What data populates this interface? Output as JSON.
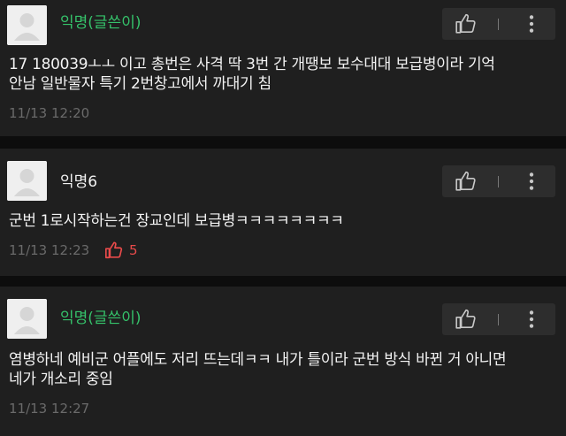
{
  "comments": [
    {
      "author": "익명(글쓴이)",
      "lines": [
        "17 180039ㅗㅗ 이고 총번은 사격 딱 3번 간 개땡보 보수대대 보급병이라 기억",
        "안남 일반물자 특기 2번창고에서 까대기 침"
      ],
      "time": "11/13 12:20"
    },
    {
      "author": "익명6",
      "lines": [
        "군번 1로시작하는건 장교인데 보급병ㅋㅋㅋㅋㅋㅋㅋㅋ"
      ],
      "time": "11/13 12:23",
      "likes": "5"
    },
    {
      "author": "익명(글쓴이)",
      "lines": [
        "염병하네 예비군 어플에도 저리 뜨는데ㅋㅋ 내가 틀이라 군번 방식 바뀐 거 아니면",
        "네가 개소리 중임"
      ],
      "time": "11/13 12:27"
    }
  ],
  "icons": {
    "avatar": "default-profile-avatar-icon",
    "like": "thumbs-up-icon",
    "more": "more-vertical-icon"
  },
  "colors": {
    "background": "#0d0d0d",
    "card": "#1f1f1f",
    "author_name": "#35c26a",
    "text": "#f3f3f3",
    "timestamp": "#6a6a6a",
    "like_count": "#e84a4a"
  }
}
